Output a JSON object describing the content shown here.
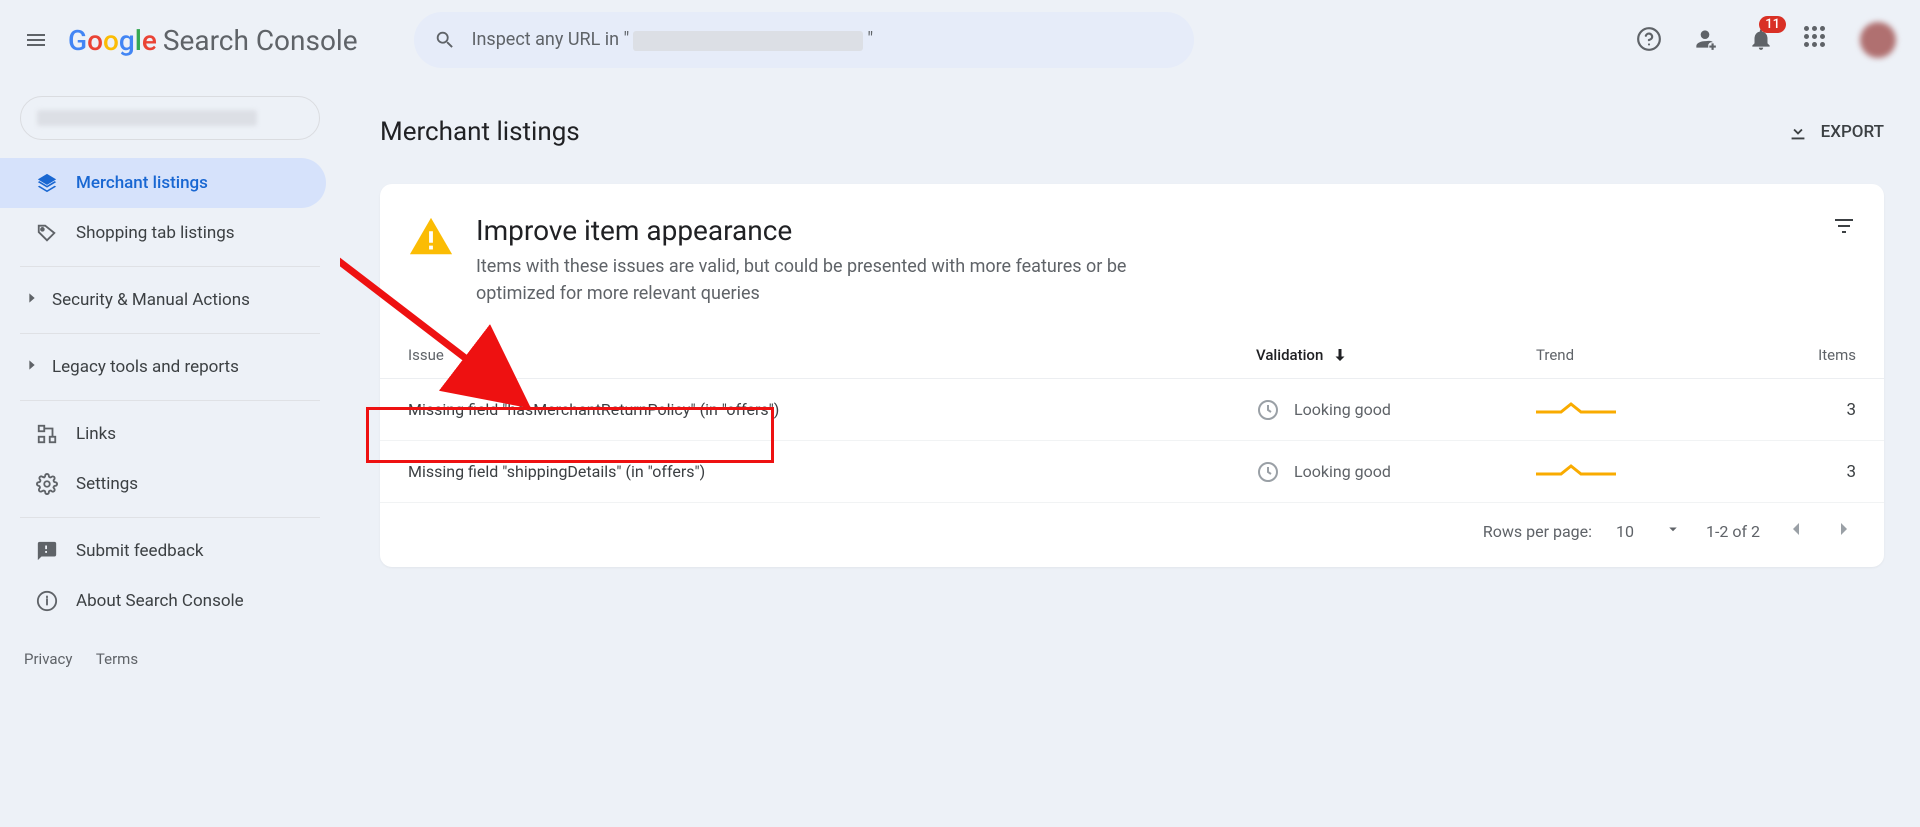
{
  "header": {
    "brand_google": "Google",
    "brand_sc": "Search Console",
    "search_placeholder_prefix": "Inspect any URL in \"",
    "search_placeholder_suffix": "\"",
    "notification_count": "11"
  },
  "sidebar": {
    "items": [
      {
        "label": "Merchant listings",
        "icon": "layers",
        "active": true
      },
      {
        "label": "Shopping tab listings",
        "icon": "tag",
        "active": false
      }
    ],
    "groups": [
      {
        "label": "Security & Manual Actions"
      },
      {
        "label": "Legacy tools and reports"
      }
    ],
    "secondary": [
      {
        "label": "Links",
        "icon": "links"
      },
      {
        "label": "Settings",
        "icon": "gear"
      }
    ],
    "tertiary": [
      {
        "label": "Submit feedback",
        "icon": "feedback"
      },
      {
        "label": "About Search Console",
        "icon": "info"
      }
    ],
    "footer": {
      "privacy": "Privacy",
      "terms": "Terms"
    }
  },
  "page": {
    "title": "Merchant listings",
    "export_label": "EXPORT",
    "card": {
      "heading": "Improve item appearance",
      "desc": "Items with these issues are valid, but could be presented with more features or be optimized for more relevant queries"
    },
    "columns": {
      "issue": "Issue",
      "validation": "Validation",
      "trend": "Trend",
      "items": "Items"
    },
    "rows": [
      {
        "issue": "Missing field \"hasMerchantReturnPolicy\" (in \"offers\")",
        "validation": "Looking good",
        "items": "3"
      },
      {
        "issue": "Missing field \"shippingDetails\" (in \"offers\")",
        "validation": "Looking good",
        "items": "3"
      }
    ],
    "pager": {
      "rpp_label": "Rows per page:",
      "rpp_value": "10",
      "range": "1-2 of 2"
    }
  }
}
